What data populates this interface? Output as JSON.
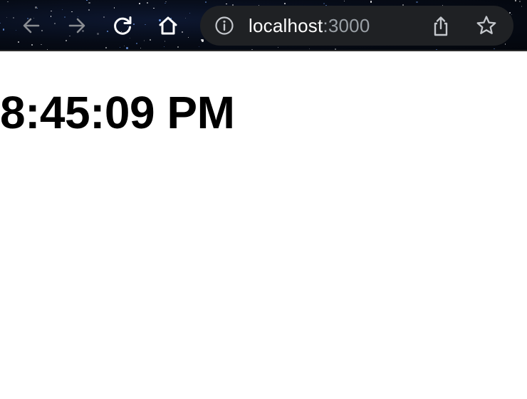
{
  "browser": {
    "url_host": "localhost",
    "url_port": ":3000",
    "icons": {
      "back": "arrow-left-icon",
      "forward": "arrow-right-icon",
      "reload": "reload-icon",
      "home": "home-icon",
      "site_info": "info-icon",
      "share": "share-icon",
      "bookmark": "star-icon"
    },
    "colors": {
      "omnibox_bg": "#1f2124",
      "url_host": "#ffffff",
      "url_port": "#9aa0a6",
      "disabled_icon": "#8a8d92"
    }
  },
  "page": {
    "time": "8:45:09 PM"
  }
}
